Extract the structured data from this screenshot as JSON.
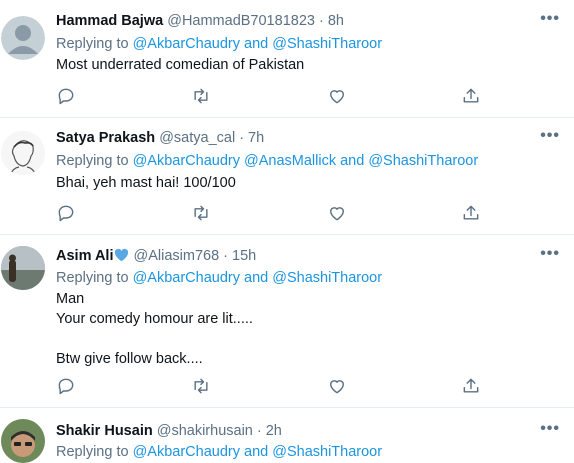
{
  "tweets": [
    {
      "name": "Hammad Bajwa",
      "handle_time": "@HammadB70181823 · 8h",
      "replying_prefix": "Replying to",
      "replying_mentions": "@AkbarChaudry and @ShashiTharoor",
      "text": "Most underrated comedian of Pakistan"
    },
    {
      "name": "Satya Prakash",
      "handle_time": "@satya_cal · 7h",
      "replying_prefix": "Replying to",
      "replying_mentions": "@AkbarChaudry @AnasMallick and @ShashiTharoor",
      "text": "Bhai, yeh mast hai! 100/100"
    },
    {
      "name": "Asim Ali",
      "name_emoji": "blue-heart-icon",
      "handle_time": "@Aliasim768 · 15h",
      "replying_prefix": "Replying to",
      "replying_mentions": "@AkbarChaudry and @ShashiTharoor",
      "text": "Man\nYour comedy homour are lit.....\n\nBtw give follow back...."
    },
    {
      "name": "Shakir Husain",
      "handle_time": "@shakirhusain · 2h",
      "replying_prefix": "Replying to",
      "replying_mentions": "@AkbarChaudry and @ShashiTharoor",
      "text": ""
    }
  ],
  "icons": {
    "more": "more-options-icon",
    "reply": "reply-icon",
    "retweet": "retweet-icon",
    "like": "like-icon",
    "share": "share-icon"
  },
  "more_glyph": "•••",
  "colors": {
    "link": "#1b95e0",
    "secondary": "#5b7083",
    "text": "#0f1419",
    "divider": "#e6ecf0",
    "heart": "#5aa7e6"
  }
}
